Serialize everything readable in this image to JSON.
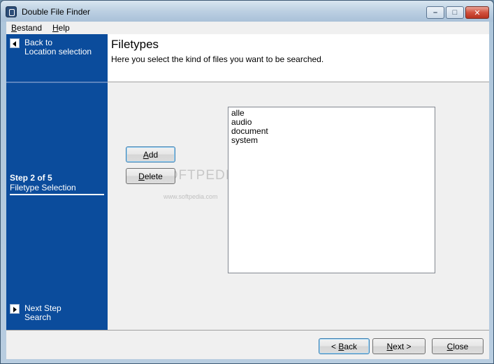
{
  "window": {
    "title": "Double File Finder"
  },
  "menu": {
    "items": [
      {
        "accel": "B",
        "rest": "estand"
      },
      {
        "accel": "H",
        "rest": "elp"
      }
    ]
  },
  "sidebar": {
    "back_line1": "Back to",
    "back_line2": "Location selection",
    "step_title": "Step 2 of 5",
    "step_subtitle": "Filetype Selection",
    "next_line1": "Next Step",
    "next_line2": "Search"
  },
  "header": {
    "title": "Filetypes",
    "description": "Here you select the kind of files you want to be searched."
  },
  "main": {
    "add_accel": "A",
    "add_rest": "dd",
    "delete_accel": "D",
    "delete_rest": "elete",
    "filetypes": [
      "alle",
      "audio",
      "document",
      "system"
    ]
  },
  "watermark": {
    "text": "SOFTPEDIA",
    "url": "www.softpedia.com"
  },
  "footer": {
    "back_prefix": "< ",
    "back_accel": "B",
    "back_rest": "ack",
    "next_accel": "N",
    "next_rest": "ext >",
    "close_accel": "C",
    "close_rest": "lose"
  },
  "colors": {
    "sidebar_bg": "#0b4c9c",
    "close_btn": "#d2513d"
  }
}
